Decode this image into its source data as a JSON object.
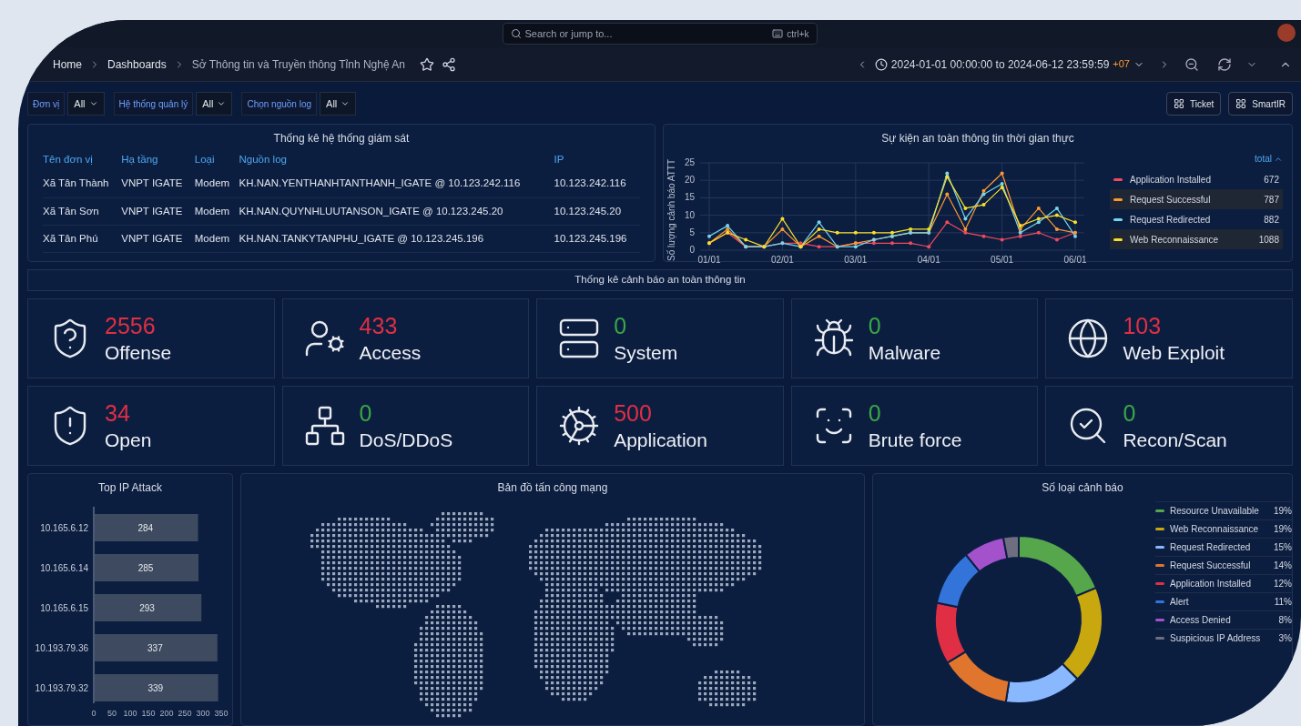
{
  "search": {
    "placeholder": "Search or jump to...",
    "shortcut": "ctrl+k"
  },
  "breadcrumb": [
    "Home",
    "Dashboards",
    "Sở Thông tin và Truyền thông Tỉnh Nghệ An"
  ],
  "time_range": {
    "range": "2024-01-01 00:00:00 to 2024-06-12 23:59:59",
    "timezone": "+07"
  },
  "variables": [
    {
      "label": "Đơn vị",
      "value": "All"
    },
    {
      "label": "Hệ thống quản lý",
      "value": "All"
    },
    {
      "label": "Chọn nguồn log",
      "value": "All"
    }
  ],
  "links": [
    "Ticket",
    "SmartIR"
  ],
  "monitoring_table": {
    "title": "Thống kê hệ thống giám sát",
    "columns": [
      "Tên đơn vị",
      "Hạ tầng",
      "Loại",
      "Nguồn log",
      "IP"
    ],
    "rows": [
      [
        "Xã Tân Thành",
        "VNPT IGATE",
        "Modem",
        "KH.NAN.YENTHANHTANTHANH_IGATE @ 10.123.242.116",
        "10.123.242.116"
      ],
      [
        "Xã Tân Sơn",
        "VNPT IGATE",
        "Modem",
        "KH.NAN.QUYNHLUUTANSON_IGATE @ 10.123.245.20",
        "10.123.245.20"
      ],
      [
        "Xã Tân Phú",
        "VNPT IGATE",
        "Modem",
        "KH.NAN.TANKYTANPHU_IGATE @ 10.123.245.196",
        "10.123.245.196"
      ]
    ]
  },
  "events_chart": {
    "title": "Sự kiện an toàn thông tin thời gian thực",
    "legend_header": "total",
    "totals": [
      "672",
      "787",
      "882",
      "1088"
    ],
    "chart_data": {
      "type": "line",
      "grid": true,
      "ylabel": "Số lượng cảnh báo ATTT",
      "categories": [
        "01/01",
        null,
        null,
        null,
        "02/01",
        null,
        null,
        null,
        "03/01",
        null,
        null,
        null,
        "04/01",
        null,
        null,
        null,
        "05/01",
        null,
        null,
        null,
        "06/01"
      ],
      "ylim": [
        0,
        25
      ],
      "yticks": [
        0,
        5,
        10,
        15,
        20,
        25
      ],
      "series": [
        {
          "name": "Application Installed",
          "color": "#f2495c",
          "values": [
            2,
            5,
            1,
            1,
            2,
            2,
            1,
            1,
            2,
            2,
            2,
            2,
            1,
            8,
            5,
            4,
            3,
            4,
            5,
            3,
            5
          ]
        },
        {
          "name": "Request Successful",
          "color": "#ff9830",
          "values": [
            2,
            6,
            1,
            1,
            6,
            1,
            4,
            1,
            2,
            3,
            4,
            5,
            5,
            16,
            6,
            17,
            22,
            6,
            12,
            6,
            5
          ]
        },
        {
          "name": "Request Redirected",
          "color": "#73d6f0",
          "values": [
            4,
            7,
            1,
            1,
            2,
            1,
            8,
            1,
            1,
            3,
            4,
            5,
            5,
            22,
            9,
            16,
            19,
            5,
            8,
            12,
            4
          ]
        },
        {
          "name": "Web Reconnaissance",
          "color": "#fade2a",
          "values": [
            2,
            5,
            3,
            1,
            9,
            1,
            6,
            5,
            5,
            5,
            5,
            6,
            6,
            21,
            12,
            13,
            18,
            7,
            9,
            10,
            8
          ]
        }
      ]
    }
  },
  "alerts_section": {
    "title": "Thống kê cảnh báo an toàn thông tin",
    "cards": [
      {
        "value": "2556",
        "label": "Offense",
        "color": "#e02f44"
      },
      {
        "value": "433",
        "label": "Access",
        "color": "#e02f44"
      },
      {
        "value": "0",
        "label": "System",
        "color": "#3aa845"
      },
      {
        "value": "0",
        "label": "Malware",
        "color": "#3aa845"
      },
      {
        "value": "103",
        "label": "Web Exploit",
        "color": "#e02f44"
      },
      {
        "value": "34",
        "label": "Open",
        "color": "#e02f44"
      },
      {
        "value": "0",
        "label": "DoS/DDoS",
        "color": "#3aa845"
      },
      {
        "value": "500",
        "label": "Application",
        "color": "#e02f44"
      },
      {
        "value": "0",
        "label": "Brute force",
        "color": "#3aa845"
      },
      {
        "value": "0",
        "label": "Recon/Scan",
        "color": "#3aa845"
      }
    ]
  },
  "top_ip": {
    "title": "Top IP Attack",
    "chart_data": {
      "type": "bar",
      "orientation": "horizontal",
      "categories": [
        "10.165.6.12",
        "10.165.6.14",
        "10.165.6.15",
        "10.193.79.36",
        "10.193.79.32"
      ],
      "values": [
        284,
        285,
        293,
        337,
        339
      ],
      "xticks": [
        0,
        50,
        100,
        150,
        200,
        250,
        300,
        350
      ],
      "xlim": [
        0,
        350
      ],
      "data_labels": true
    }
  },
  "attack_map": {
    "title": "Bản đồ tấn công mạng"
  },
  "alert_types": {
    "title": "Số loại cảnh báo",
    "percents": [
      "19%",
      "19%",
      "15%",
      "14%",
      "12%",
      "11%",
      "8%",
      "3%"
    ],
    "chart_data": {
      "type": "donut",
      "categories": [
        "Resource Unavailable",
        "Web Reconnaissance",
        "Request Redirected",
        "Request Successful",
        "Application Installed",
        "Alert",
        "Access Denied",
        "Suspicious IP Address"
      ],
      "values": [
        19,
        19,
        15,
        14,
        12,
        11,
        8,
        3
      ],
      "colors": [
        "#56a64b",
        "#c8a80e",
        "#8ab8ff",
        "#e0752d",
        "#e02f44",
        "#3274d9",
        "#a352cc",
        "#6e6e80"
      ]
    }
  }
}
